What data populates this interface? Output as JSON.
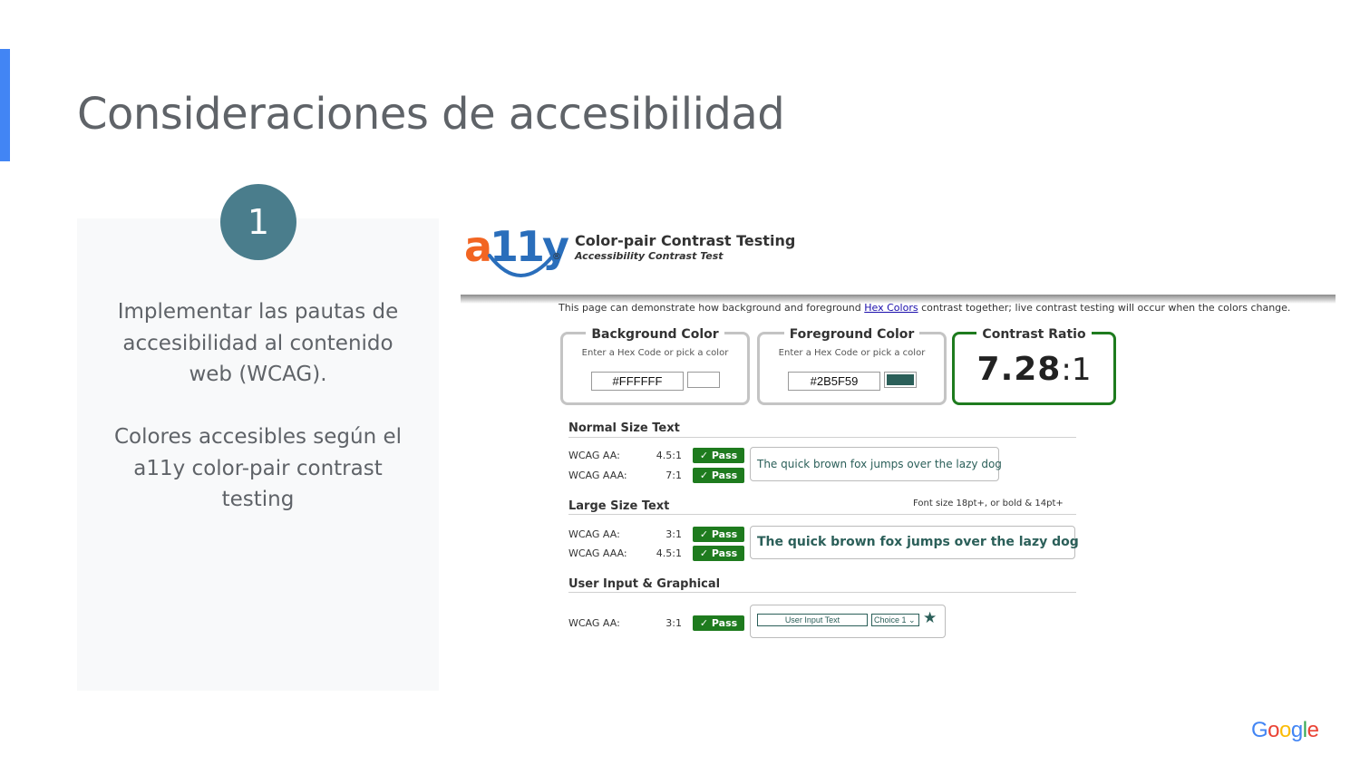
{
  "slide": {
    "title": "Consideraciones de accesibilidad",
    "step_number": "1",
    "paragraph1": "Implementar las pautas de accesibilidad al contenido web (WCAG).",
    "paragraph2": "Colores accesibles según el a11y color-pair contrast testing",
    "accent_color": "#4285f4",
    "circle_color": "#4a7d8c"
  },
  "tool": {
    "logo": "a11y",
    "title": "Color-pair Contrast Testing",
    "subtitle": "Accessibility Contrast Test",
    "intro_before": "This page can demonstrate how background and foreground ",
    "intro_link": "Hex Colors",
    "intro_after": " contrast together; live contrast testing will occur when the colors change.",
    "background": {
      "legend": "Background Color",
      "hint": "Enter a Hex Code or pick a color",
      "value": "#FFFFFF",
      "swatch": "#ffffff"
    },
    "foreground": {
      "legend": "Foreground Color",
      "hint": "Enter a Hex Code or pick a color",
      "value": "#2B5F59",
      "swatch": "#2b5f59"
    },
    "contrast": {
      "legend": "Contrast Ratio",
      "value": "7.28",
      "suffix": ":1"
    },
    "normal": {
      "title": "Normal Size Text",
      "rows": [
        {
          "label": "WCAG AA:",
          "ratio": "4.5:1",
          "status": "✓ Pass"
        },
        {
          "label": "WCAG AAA:",
          "ratio": "7:1",
          "status": "✓ Pass"
        }
      ],
      "sample": "The quick brown fox jumps over the lazy dog"
    },
    "large": {
      "title": "Large Size Text",
      "note": "Font size 18pt+, or bold & 14pt+",
      "rows": [
        {
          "label": "WCAG AA:",
          "ratio": "3:1",
          "status": "✓ Pass"
        },
        {
          "label": "WCAG AAA:",
          "ratio": "4.5:1",
          "status": "✓ Pass"
        }
      ],
      "sample": "The quick brown fox jumps over the lazy dog"
    },
    "graphical": {
      "title": "User Input & Graphical",
      "rows": [
        {
          "label": "WCAG AA:",
          "ratio": "3:1",
          "status": "✓ Pass"
        }
      ],
      "input_text": "User Input Text",
      "select_value": "Choice 1 ⌄",
      "star": "★"
    },
    "pass_color": "#1e7b1e"
  },
  "brand": {
    "google": [
      "G",
      "o",
      "o",
      "g",
      "l",
      "e"
    ]
  }
}
